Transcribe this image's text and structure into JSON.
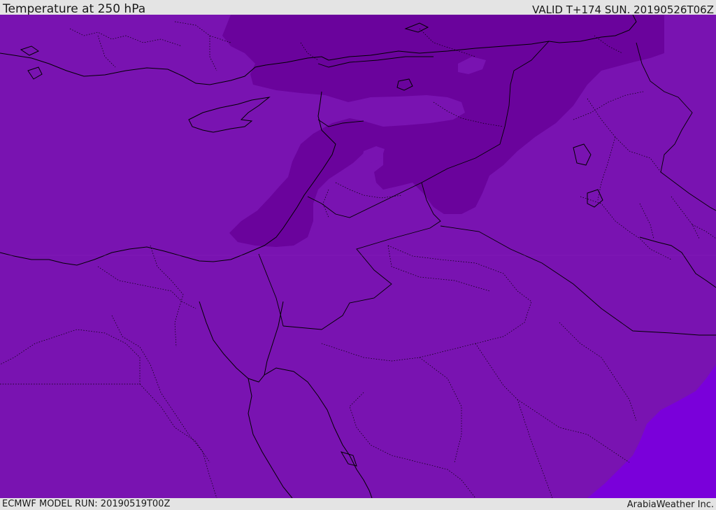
{
  "header": {
    "title": "Temperature at 250 hPa",
    "valid": "VALID T+174 SUN. 20190526T06Z"
  },
  "footer": {
    "model_run": "ECMWF MODEL RUN: 20190519T00Z",
    "credit": "ArabiaWeather Inc."
  },
  "map": {
    "field": "Temperature at 250 hPa",
    "colors": {
      "base": "#7913b1",
      "cold": "#6a039c",
      "warm": "#7a00da",
      "boundary": "#000000"
    },
    "features": [
      "coastline",
      "country-borders",
      "province-borders",
      "temperature-shading"
    ]
  }
}
